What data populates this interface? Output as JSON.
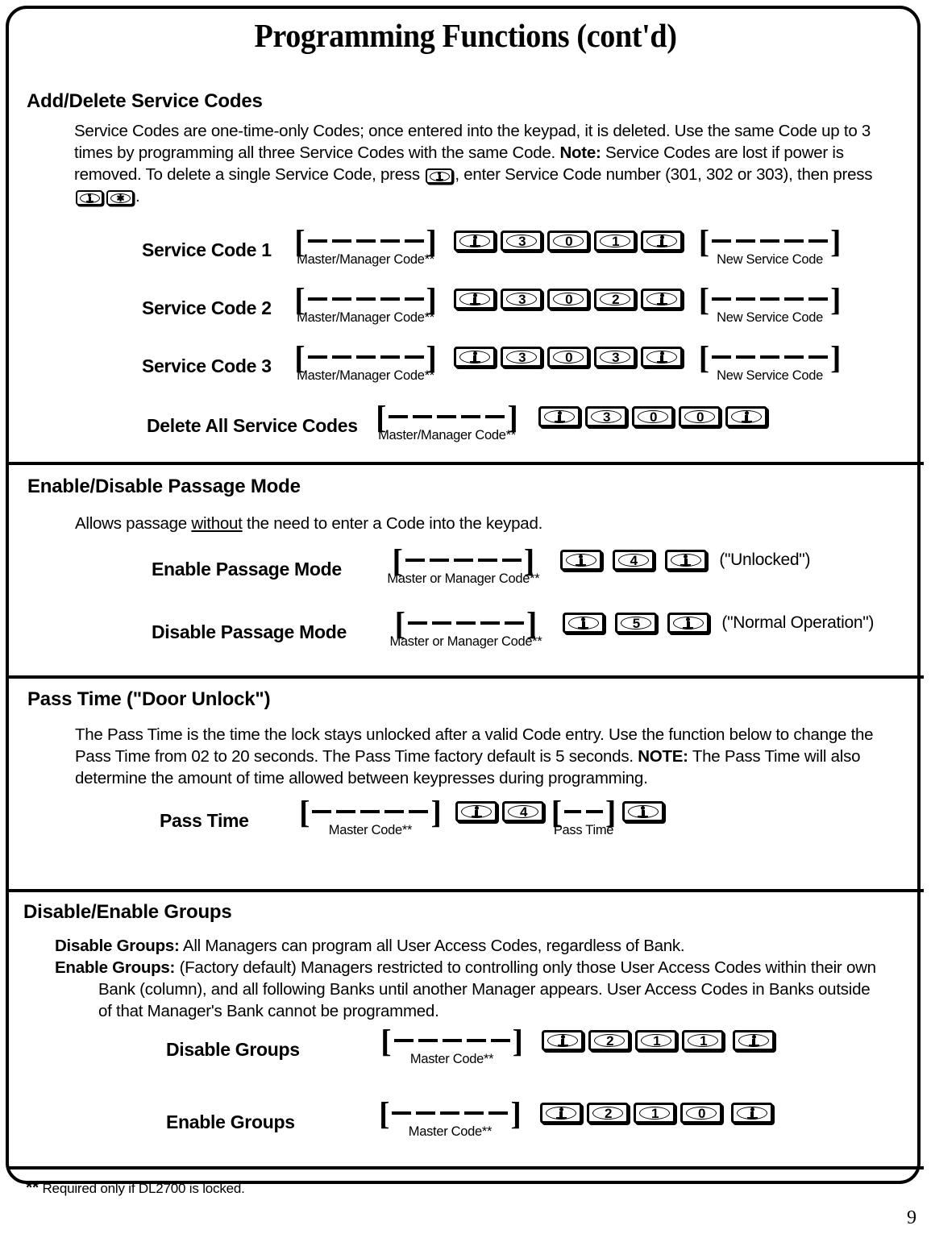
{
  "document": {
    "title": "Programming Functions (cont'd)",
    "page_number": "9",
    "footnote_markers": "**",
    "footnote_text": "Required only if DL2700 is locked."
  },
  "sections": [
    {
      "heading": "Add/Delete Service Codes",
      "paragraph": {
        "part1": "Service Codes are one-time-only Codes; once entered into the keypad, it is deleted.  Use the same Code up to 3 times by programming all three Service Codes with the same Code.  ",
        "note_bold": "Note:",
        "part2": "  Service Codes are lost if power is removed.  To delete a single Service Code, press ",
        "part3": ", enter Service Code number (301, 302 or 303), then press ",
        "part4": "."
      },
      "rows": [
        {
          "label": "Service Code 1",
          "left_blanks": 5,
          "left_caption": "Master/Manager Code**",
          "keys": [
            "program",
            "3",
            "0",
            "1",
            "program"
          ],
          "right_blanks": 5,
          "right_caption": "New Service Code"
        },
        {
          "label": "Service Code 2",
          "left_blanks": 5,
          "left_caption": "Master/Manager Code**",
          "keys": [
            "program",
            "3",
            "0",
            "2",
            "program"
          ],
          "right_blanks": 5,
          "right_caption": "New Service Code"
        },
        {
          "label": "Service Code 3",
          "left_blanks": 5,
          "left_caption": "Master/Manager Code**",
          "keys": [
            "program",
            "3",
            "0",
            "3",
            "program"
          ],
          "right_blanks": 5,
          "right_caption": "New Service Code"
        },
        {
          "label": "Delete All Service Codes",
          "left_blanks": 5,
          "left_caption": "Master/Manager Code**",
          "keys": [
            "program",
            "3",
            "0",
            "0",
            "program"
          ],
          "right_blanks": 0,
          "right_caption": ""
        }
      ]
    },
    {
      "heading": "Enable/Disable Passage Mode",
      "paragraph": {
        "pre": "Allows passage ",
        "underlined": "without",
        "post": " the need to enter a Code into the keypad."
      },
      "rows": [
        {
          "label": "Enable Passage Mode",
          "left_blanks": 5,
          "left_caption": "Master or Manager Code**",
          "keys": [
            "program",
            "4",
            "program"
          ],
          "trailing_note": "(\"Unlocked\")"
        },
        {
          "label": "Disable Passage Mode",
          "left_blanks": 5,
          "left_caption": "Master or Manager Code**",
          "keys": [
            "program",
            "5",
            "program"
          ],
          "trailing_note": "(\"Normal Operation\")"
        }
      ]
    },
    {
      "heading": "Pass Time (\"Door Unlock\")",
      "paragraph": {
        "part1": "The Pass Time is the time the lock stays unlocked after a valid Code entry.  Use the function below to change the Pass Time from 02 to 20 seconds.  The Pass Time factory default is 5 seconds.  ",
        "note_bold": "NOTE:",
        "part2": "  The Pass Time will also determine the amount of time allowed between keypresses during programming."
      },
      "rows": [
        {
          "label": "Pass Time",
          "left_blanks": 5,
          "left_caption": "Master Code**",
          "keys": [
            "program",
            "4"
          ],
          "mid_blanks": 2,
          "mid_caption": "Pass Time",
          "keys_after": [
            "program"
          ]
        }
      ]
    },
    {
      "heading": "Disable/Enable Groups",
      "paragraph": {
        "line1_bold": "Disable Groups:",
        "line1_text": "  All Managers can program all User Access Codes, regardless of Bank.",
        "line2_bold": "Enable Groups:",
        "line2_text": "  (Factory default)  Managers restricted to controlling only those User Access Codes within their own Bank (column), and all following Banks until another Manager appears.  User Access Codes in Banks outside of that Manager's Bank cannot be programmed."
      },
      "rows": [
        {
          "label": "Disable Groups",
          "left_blanks": 5,
          "left_caption": "Master Code**",
          "keys": [
            "program",
            "2",
            "1",
            "1",
            "program"
          ]
        },
        {
          "label": "Enable Groups",
          "left_blanks": 5,
          "left_caption": "Master Code**",
          "keys": [
            "program",
            "2",
            "1",
            "0",
            "program"
          ]
        }
      ]
    }
  ],
  "icons": {
    "program_key": "program-key-icon",
    "star_key": "star-key-icon"
  },
  "colors": {
    "ink": "#000000",
    "paper": "#ffffff"
  }
}
